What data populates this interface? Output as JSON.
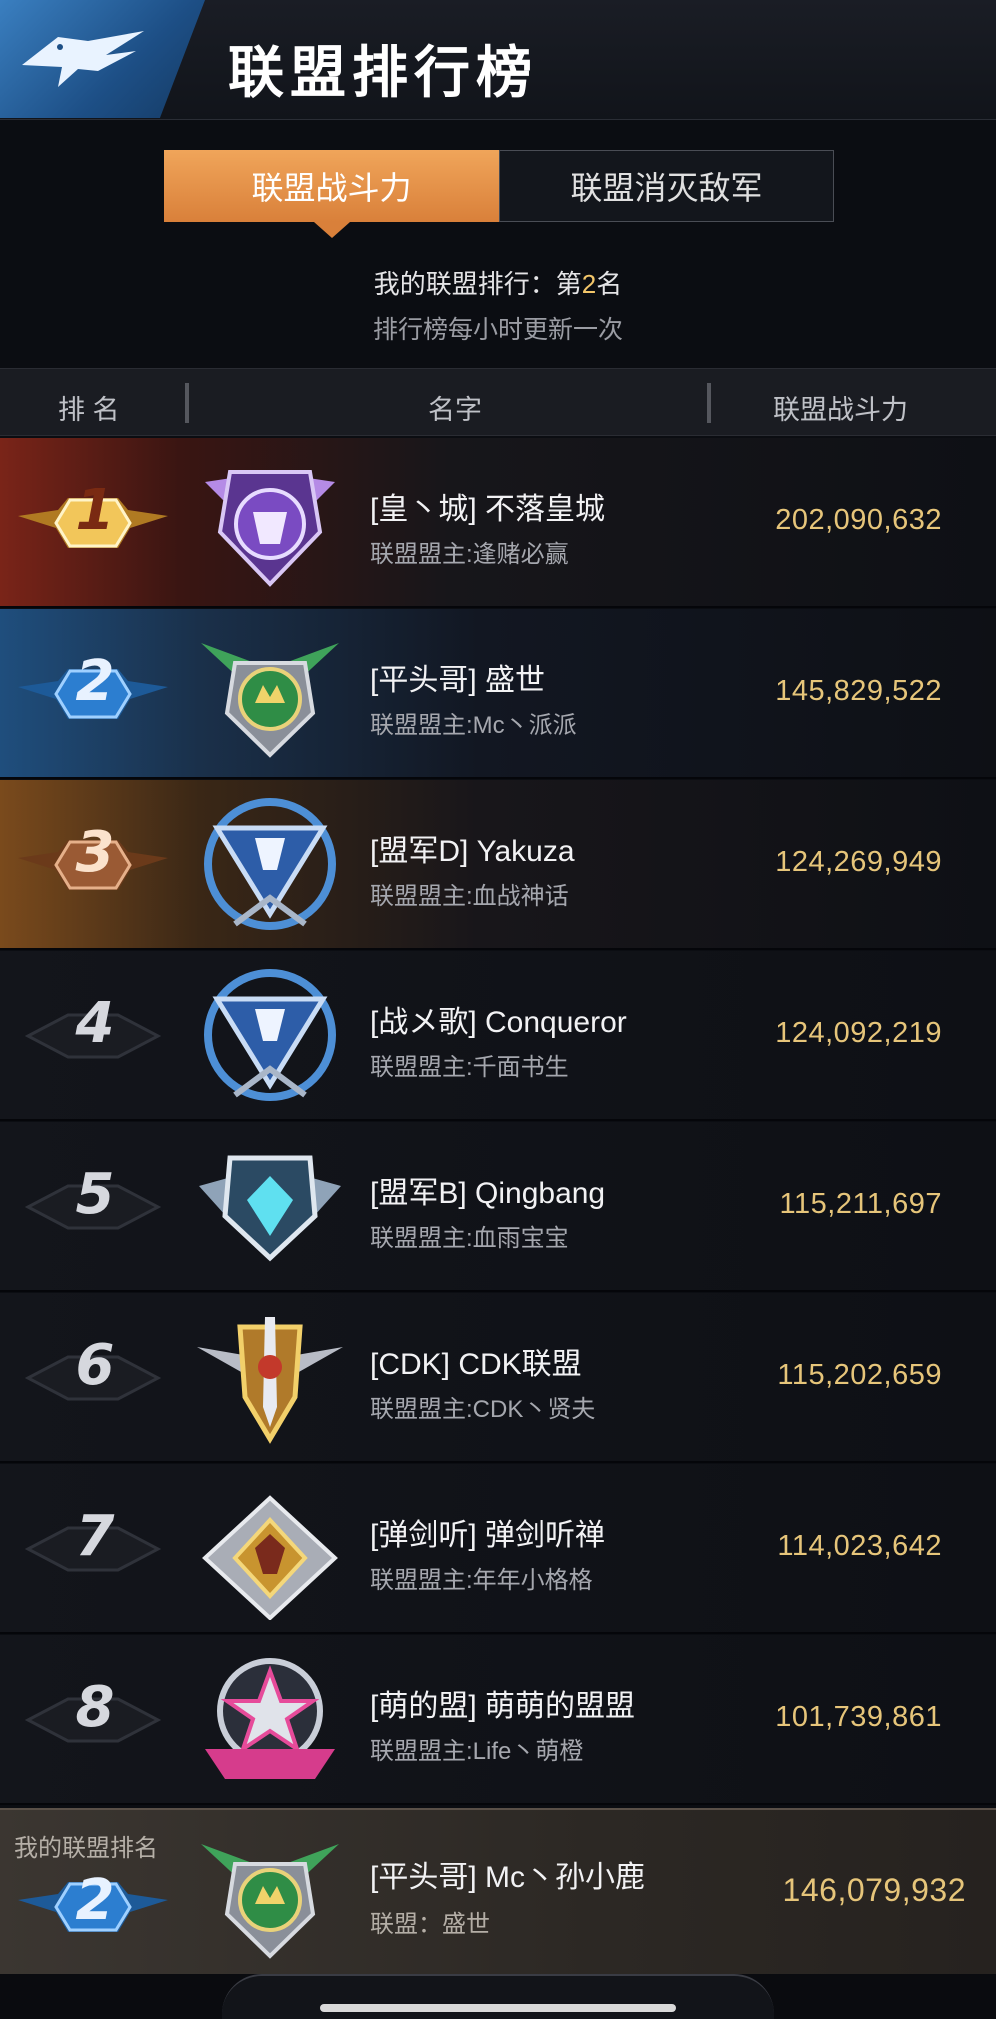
{
  "header": {
    "title": "联盟排行榜"
  },
  "tabs": [
    {
      "label": "联盟战斗力",
      "active": true
    },
    {
      "label": "联盟消灭敌军",
      "active": false
    }
  ],
  "my_rank": {
    "prefix": "我的联盟排行：第",
    "rank": "2",
    "suffix": "名"
  },
  "update_note": "排行榜每小时更新一次",
  "columns": {
    "rank": "排 名",
    "name": "名字",
    "power": "联盟战斗力"
  },
  "rows": [
    {
      "rank": "1",
      "name": "[皇丶城] 不落皇城",
      "leader": "联盟盟主:逢赌必赢",
      "power": "202,090,632",
      "emblem_icon": "purple-tiger-emblem-icon"
    },
    {
      "rank": "2",
      "name": "[平头哥] 盛世",
      "leader": "联盟盟主:Mc丶派派",
      "power": "145,829,522",
      "emblem_icon": "green-winged-emblem-icon"
    },
    {
      "rank": "3",
      "name": "[盟军D] Yakuza",
      "leader": "联盟盟主:血战神话",
      "power": "124,269,949",
      "emblem_icon": "blue-eagle-emblem-icon"
    },
    {
      "rank": "4",
      "name": "[战メ歌] Conqueror",
      "leader": "联盟盟主:千面书生",
      "power": "124,092,219",
      "emblem_icon": "blue-eagle-emblem-icon"
    },
    {
      "rank": "5",
      "name": "[盟军B] Qingbang",
      "leader": "联盟盟主:血雨宝宝",
      "power": "115,211,697",
      "emblem_icon": "cyan-shield-emblem-icon"
    },
    {
      "rank": "6",
      "name": "[CDK] CDK联盟",
      "leader": "联盟盟主:CDK丶贤夫",
      "power": "115,202,659",
      "emblem_icon": "gold-sword-emblem-icon"
    },
    {
      "rank": "7",
      "name": "[弹剑听] 弹剑听禅",
      "leader": "联盟盟主:年年小格格",
      "power": "114,023,642",
      "emblem_icon": "wolf-emblem-icon"
    },
    {
      "rank": "8",
      "name": "[萌的盟] 萌萌的盟盟",
      "leader": "联盟盟主:Life丶萌橙",
      "power": "101,739,861",
      "emblem_icon": "pink-star-emblem-icon"
    }
  ],
  "mine": {
    "label": "我的联盟排名",
    "rank": "2",
    "name": "[平头哥] Mc丶孙小鹿",
    "alliance": "联盟：盛世",
    "power": "146,079,932",
    "emblem_icon": "green-winged-emblem-icon"
  },
  "colors": {
    "accent_orange": "#e08a3f",
    "gold_text": "#e6c57a",
    "rank1_bg": "#7a2418",
    "rank2_bg": "#1f4e7d",
    "rank3_bg": "#7a4a1c"
  }
}
